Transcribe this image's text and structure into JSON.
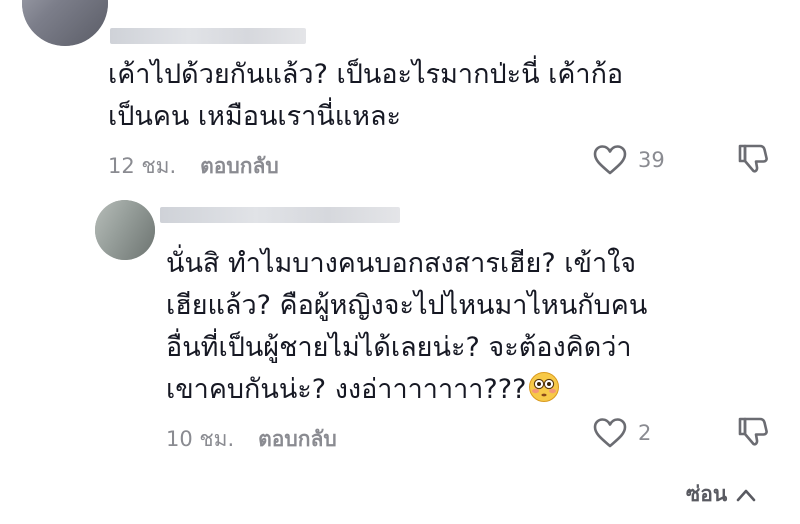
{
  "comments": [
    {
      "avatar_icon": "blurred-avatar",
      "username": "",
      "text_lines": [
        "เค้าไปด้วยกันแล้ว? เป็นอะไรมากป่ะนี่ เค้าก้อ",
        "เป็นคน เหมือนเรานี่แหละ"
      ],
      "time": "12 ชม.",
      "reply_label": "ตอบกลับ",
      "likes": "39"
    },
    {
      "avatar_icon": "blurred-avatar",
      "username": "",
      "text_lines": [
        "นั่นสิ ทำไมบางคนบอกสงสารเฮีย? เข้าใจ",
        "เฮียแล้ว? คือผู้หญิงจะไปไหนมาไหนกับคน",
        "อื่นที่เป็นผู้ชายไม่ได้เลยน่ะ? จะต้องคิดว่า",
        "เขาคบกันน่ะ? งงอ่าาาาาาา???"
      ],
      "emoji_icon": "flushed-face-emoji",
      "time": "10 ชม.",
      "reply_label": "ตอบกลับ",
      "likes": "2"
    }
  ],
  "hide_replies": {
    "label": "ซ่อน",
    "icon": "chevron-up-icon"
  },
  "colors": {
    "text": "#161823",
    "meta": "#8a8b91",
    "icon": "#6b6c72"
  }
}
